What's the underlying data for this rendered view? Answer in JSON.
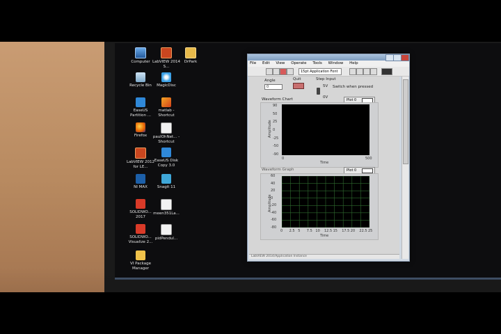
{
  "desktop": {
    "icons": [
      {
        "label": "Computer",
        "icon": "computer-icon"
      },
      {
        "label": "LabVIEW 2014 S...",
        "icon": "labview-icon"
      },
      {
        "label": "DrPark",
        "icon": "folder-icon"
      },
      {
        "label": "Recycle Bin",
        "icon": "recycle-bin-icon"
      },
      {
        "label": "MagicDisc",
        "icon": "magicdisc-icon"
      },
      {
        "label": "EaseUS Partition ...",
        "icon": "easeus-icon"
      },
      {
        "label": "matlab - Shortcut",
        "icon": "matlab-icon"
      },
      {
        "label": "Firefox",
        "icon": "firefox-icon"
      },
      {
        "label": "paulOhNet... - Shortcut",
        "icon": "document-icon"
      },
      {
        "label": "LabVIEW 2012 for LE...",
        "icon": "labview-icon"
      },
      {
        "label": "EaseUS Disk Copy 3.0",
        "icon": "easeus-icon"
      },
      {
        "label": "NI MAX",
        "icon": "ni-max-icon"
      },
      {
        "label": "Snagit 11",
        "icon": "snagit-icon"
      },
      {
        "label": "SOLIDWO... 2017",
        "icon": "solidworks-icon"
      },
      {
        "label": "meen351La...",
        "icon": "document-icon"
      },
      {
        "label": "SOLIDWO... Visualize 2...",
        "icon": "solidworks-icon"
      },
      {
        "label": "pidPendul...",
        "icon": "document-icon"
      },
      {
        "label": "VI Package Manager",
        "icon": "vipm-icon"
      }
    ]
  },
  "window": {
    "menu": [
      "File",
      "Edit",
      "View",
      "Operate",
      "Tools",
      "Window",
      "Help"
    ],
    "font_select": "15pt Application Font",
    "status_text": "LabVIEW 2014/Application Instance"
  },
  "panel": {
    "angle_label": "Angle",
    "angle_value": "0",
    "quit_label": "Quit",
    "step_input_label": "Step Input",
    "step_high": "5V",
    "step_low": "0V",
    "switch_caption": "Switch when pressed",
    "chart": {
      "title": "Waveform Chart",
      "legend": "Plot 0",
      "ylabel": "Amplitude",
      "xlabel": "Time",
      "y_ticks": [
        "90",
        "50",
        "25",
        "0",
        "-25",
        "-50",
        "-90"
      ],
      "x_ticks": [
        "0",
        "500"
      ]
    },
    "graph": {
      "title": "Waveform Graph",
      "legend": "Plot 0",
      "ylabel": "Amplitude",
      "xlabel": "Time",
      "y_ticks": [
        "60",
        "40",
        "20",
        "0",
        "-20",
        "-40",
        "-60",
        "-80"
      ],
      "x_ticks": [
        "0",
        "2.5",
        "5",
        "7.5",
        "10",
        "12.5",
        "15",
        "17.5",
        "20",
        "22.5",
        "25"
      ]
    }
  },
  "taskbar": {
    "buttons": [
      "explorer-icon",
      "firefox-icon",
      "network-icon",
      "labview-icon",
      "media-icon",
      "labview-vi-icon",
      "tool-icon",
      "tool-icon"
    ]
  },
  "colors": {
    "chart_bg": "#000000",
    "grid": "#2f6b2f",
    "stop_button": "#c86f6f"
  }
}
